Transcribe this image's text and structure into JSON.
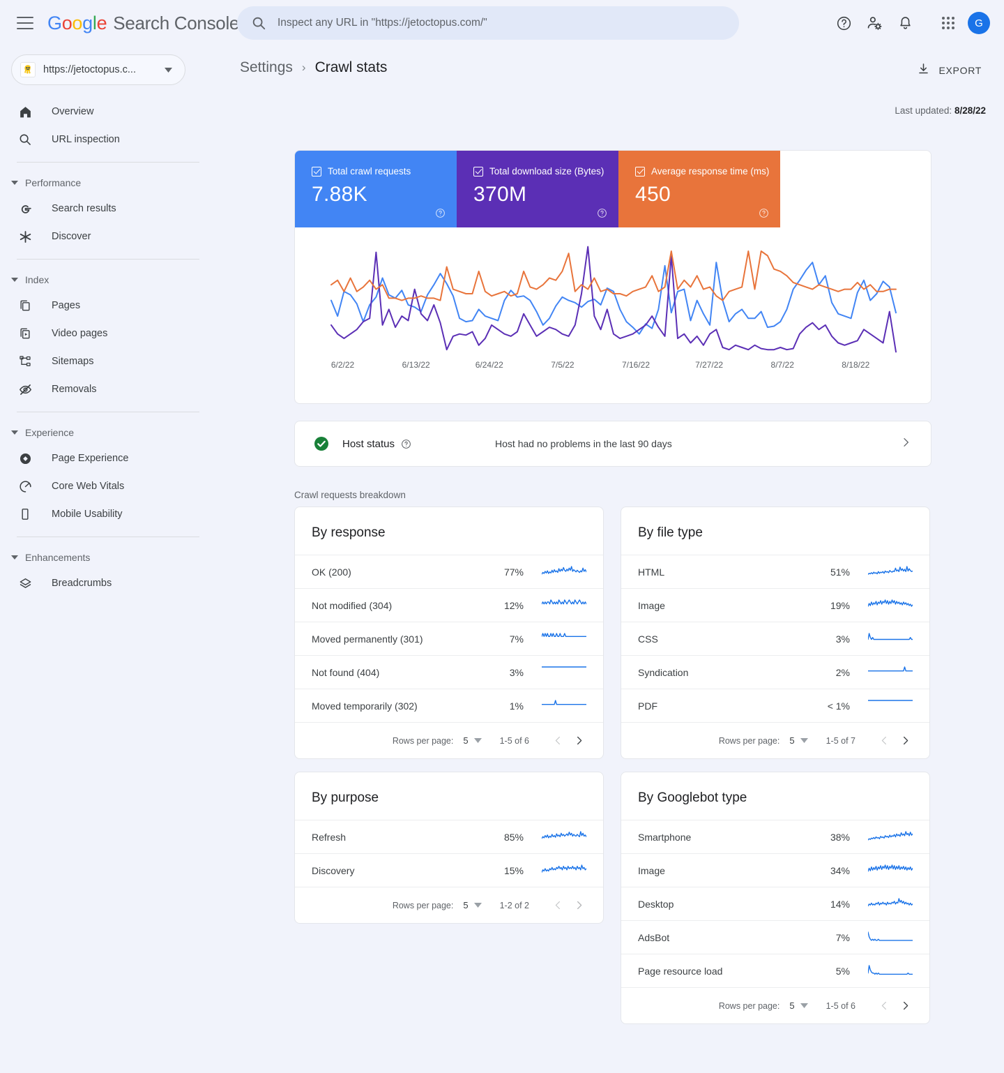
{
  "app": {
    "brand_letters": [
      "G",
      "o",
      "o",
      "g",
      "l",
      "e"
    ],
    "brand_suffix": "Search Console",
    "avatar_initial": "G"
  },
  "search": {
    "placeholder": "Inspect any URL in \"https://jetoctopus.com/\"",
    "value": ""
  },
  "topbar_icons": [
    {
      "name": "help-icon",
      "label": "Help"
    },
    {
      "name": "account-settings-icon",
      "label": "Settings"
    },
    {
      "name": "notifications-icon",
      "label": "Notifications"
    },
    {
      "name": "apps-grid-icon",
      "label": "Google apps"
    }
  ],
  "property": {
    "name": "https://jetoctopus.c...",
    "favicon": "octopus-favicon"
  },
  "sidebar": {
    "items": [
      {
        "label": "Overview",
        "icon": "home-icon"
      },
      {
        "label": "URL inspection",
        "icon": "search-icon"
      }
    ],
    "groups": [
      {
        "label": "Performance",
        "items": [
          {
            "label": "Search results",
            "icon": "google-g-icon"
          },
          {
            "label": "Discover",
            "icon": "discover-asterisk-icon"
          }
        ]
      },
      {
        "label": "Index",
        "items": [
          {
            "label": "Pages",
            "icon": "pages-copy-icon"
          },
          {
            "label": "Video pages",
            "icon": "video-pages-icon"
          },
          {
            "label": "Sitemaps",
            "icon": "sitemaps-icon"
          },
          {
            "label": "Removals",
            "icon": "removals-eye-off-icon"
          }
        ]
      },
      {
        "label": "Experience",
        "items": [
          {
            "label": "Page Experience",
            "icon": "page-experience-icon"
          },
          {
            "label": "Core Web Vitals",
            "icon": "core-web-vitals-gauge-icon"
          },
          {
            "label": "Mobile Usability",
            "icon": "mobile-device-icon"
          }
        ]
      },
      {
        "label": "Enhancements",
        "items": [
          {
            "label": "Breadcrumbs",
            "icon": "breadcrumbs-layers-icon"
          }
        ]
      }
    ]
  },
  "breadcrumb": {
    "parent": "Settings",
    "separator": "›",
    "current": "Crawl stats"
  },
  "export": {
    "label": "EXPORT",
    "icon": "download-icon"
  },
  "last_updated": {
    "prefix": "Last updated:",
    "date": "8/28/22"
  },
  "metrics": [
    {
      "label": "Total crawl requests",
      "value": "7.88K",
      "color": "#4285F4",
      "checked": true
    },
    {
      "label": "Total download size (Bytes)",
      "value": "370M",
      "color": "#5B2FB5",
      "checked": true
    },
    {
      "label": "Average response time (ms)",
      "value": "450",
      "color": "#E8743B",
      "checked": true
    }
  ],
  "host_status": {
    "label": "Host status",
    "message": "Host had no problems in the last 90 days",
    "state": "ok",
    "icon": "check-circle-icon"
  },
  "breakdown_heading": "Crawl requests breakdown",
  "pagination_labels": {
    "rows_per_page": "Rows per page:"
  },
  "cards": [
    {
      "title": "By response",
      "rows": [
        {
          "label": "OK (200)",
          "pct": "77%"
        },
        {
          "label": "Not modified (304)",
          "pct": "12%"
        },
        {
          "label": "Moved permanently (301)",
          "pct": "7%"
        },
        {
          "label": "Not found (404)",
          "pct": "3%"
        },
        {
          "label": "Moved temporarily (302)",
          "pct": "1%"
        }
      ],
      "rows_per_page": "5",
      "range": "1-5 of 6",
      "prev_enabled": false,
      "next_enabled": true
    },
    {
      "title": "By file type",
      "rows": [
        {
          "label": "HTML",
          "pct": "51%"
        },
        {
          "label": "Image",
          "pct": "19%"
        },
        {
          "label": "CSS",
          "pct": "3%"
        },
        {
          "label": "Syndication",
          "pct": "2%"
        },
        {
          "label": "PDF",
          "pct": "< 1%"
        }
      ],
      "rows_per_page": "5",
      "range": "1-5 of 7",
      "prev_enabled": false,
      "next_enabled": true
    },
    {
      "title": "By purpose",
      "rows": [
        {
          "label": "Refresh",
          "pct": "85%"
        },
        {
          "label": "Discovery",
          "pct": "15%"
        }
      ],
      "rows_per_page": "5",
      "range": "1-2 of 2",
      "prev_enabled": false,
      "next_enabled": false
    },
    {
      "title": "By Googlebot type",
      "rows": [
        {
          "label": "Smartphone",
          "pct": "38%"
        },
        {
          "label": "Image",
          "pct": "34%"
        },
        {
          "label": "Desktop",
          "pct": "14%"
        },
        {
          "label": "AdsBot",
          "pct": "7%"
        },
        {
          "label": "Page resource load",
          "pct": "5%"
        }
      ],
      "rows_per_page": "5",
      "range": "1-5 of 6",
      "prev_enabled": false,
      "next_enabled": true
    }
  ],
  "chart_data": {
    "type": "line",
    "title": "",
    "xlabel": "",
    "ylabel": "",
    "grid": false,
    "legend": "none",
    "x_tick_labels": [
      "6/2/22",
      "6/13/22",
      "6/24/22",
      "7/5/22",
      "7/16/22",
      "7/27/22",
      "8/7/22",
      "8/18/22"
    ],
    "x_tick_positions_pct": [
      7.5,
      19.0,
      30.5,
      42.0,
      53.5,
      65.0,
      76.5,
      88.0
    ],
    "series": [
      {
        "name": "Total crawl requests",
        "color": "#4285F4",
        "values": [
          52,
          38,
          60,
          57,
          49,
          33,
          48,
          55,
          72,
          57,
          54,
          61,
          48,
          46,
          42,
          57,
          66,
          76,
          67,
          56,
          36,
          33,
          34,
          44,
          38,
          36,
          34,
          52,
          61,
          55,
          56,
          52,
          42,
          30,
          36,
          47,
          55,
          52,
          50,
          46,
          51,
          53,
          48,
          63,
          60,
          44,
          33,
          28,
          22,
          31,
          27,
          44,
          83,
          41,
          60,
          62,
          34,
          52,
          40,
          30,
          86,
          52,
          33,
          40,
          44,
          36,
          36,
          42,
          28,
          29,
          33,
          44,
          62,
          70,
          79,
          86,
          66,
          74,
          50,
          40,
          38,
          36,
          59,
          70,
          52,
          58,
          69,
          64,
          41
        ]
      },
      {
        "name": "Total download size (Bytes)",
        "color": "#5B2FB5",
        "values": [
          30,
          22,
          18,
          22,
          26,
          33,
          36,
          95,
          30,
          44,
          28,
          38,
          34,
          62,
          40,
          34,
          48,
          32,
          8,
          20,
          22,
          21,
          24,
          12,
          18,
          30,
          26,
          22,
          20,
          24,
          40,
          30,
          20,
          24,
          28,
          26,
          22,
          20,
          30,
          58,
          100,
          38,
          26,
          44,
          22,
          18,
          20,
          22,
          26,
          30,
          38,
          28,
          20,
          92,
          18,
          22,
          14,
          20,
          12,
          22,
          26,
          10,
          8,
          12,
          10,
          8,
          12,
          9,
          8,
          8,
          10,
          8,
          9,
          22,
          28,
          32,
          26,
          30,
          20,
          14,
          12,
          14,
          16,
          26,
          22,
          18,
          14,
          42,
          6
        ]
      },
      {
        "name": "Average response time (ms)",
        "color": "#E8743B",
        "values": [
          66,
          70,
          60,
          72,
          60,
          64,
          70,
          62,
          66,
          54,
          54,
          52,
          54,
          54,
          56,
          54,
          54,
          52,
          82,
          62,
          60,
          58,
          58,
          78,
          60,
          56,
          58,
          60,
          56,
          58,
          78,
          64,
          62,
          66,
          72,
          70,
          78,
          94,
          60,
          66,
          62,
          72,
          60,
          62,
          58,
          58,
          56,
          60,
          62,
          64,
          74,
          60,
          64,
          96,
          62,
          70,
          64,
          74,
          62,
          64,
          56,
          52,
          60,
          62,
          64,
          96,
          62,
          96,
          92,
          80,
          78,
          74,
          68,
          66,
          64,
          62,
          66,
          64,
          62,
          60,
          62,
          62,
          68,
          62,
          66,
          60,
          60,
          62,
          62
        ]
      }
    ]
  },
  "sparklines": {
    "response": [
      [
        8,
        11,
        9,
        13,
        10,
        14,
        9,
        12,
        10,
        15,
        11,
        16,
        12,
        14,
        11,
        18,
        13,
        17,
        14,
        20,
        15,
        13,
        17,
        14,
        19,
        15,
        22,
        13,
        16,
        14,
        12,
        15,
        13,
        11,
        14,
        12,
        19,
        13,
        16,
        12
      ],
      [
        4,
        5,
        4,
        5,
        4,
        5,
        5,
        4,
        6,
        5,
        4,
        5,
        4,
        5,
        4,
        6,
        5,
        4,
        5,
        4,
        6,
        5,
        4,
        5,
        6,
        5,
        4,
        5,
        4,
        6,
        5,
        4,
        5,
        6,
        5,
        4,
        5,
        4,
        5,
        4
      ],
      [
        3,
        4,
        3,
        4,
        3,
        4,
        3,
        3,
        4,
        3,
        4,
        3,
        3,
        4,
        3,
        3,
        4,
        3,
        3,
        3,
        4,
        3,
        3,
        3,
        3,
        3,
        3,
        3,
        3,
        3,
        3,
        3,
        3,
        3,
        3,
        3,
        3,
        3,
        3,
        3
      ],
      [
        2,
        2,
        2,
        2,
        2,
        2,
        2,
        2,
        2,
        2,
        2,
        2,
        2,
        2,
        2,
        2,
        2,
        2,
        2,
        2,
        2,
        2,
        2,
        2,
        2,
        2,
        2,
        2,
        2,
        2,
        2,
        2,
        2,
        2,
        2,
        2,
        2,
        2,
        2,
        2
      ],
      [
        2,
        2,
        2,
        2,
        2,
        2,
        2,
        2,
        2,
        2,
        2,
        2,
        3,
        2,
        2,
        2,
        2,
        2,
        2,
        2,
        2,
        2,
        2,
        2,
        2,
        2,
        2,
        2,
        2,
        2,
        2,
        2,
        2,
        2,
        2,
        2,
        2,
        2,
        2,
        2
      ]
    ],
    "filetype": [
      [
        7,
        9,
        8,
        10,
        8,
        11,
        9,
        10,
        8,
        12,
        9,
        11,
        10,
        12,
        9,
        13,
        11,
        12,
        10,
        14,
        12,
        11,
        13,
        12,
        18,
        13,
        15,
        12,
        20,
        14,
        17,
        13,
        16,
        12,
        21,
        13,
        17,
        14,
        12,
        13
      ],
      [
        8,
        12,
        9,
        14,
        10,
        13,
        11,
        15,
        10,
        14,
        12,
        16,
        11,
        15,
        13,
        17,
        12,
        16,
        11,
        15,
        12,
        17,
        13,
        16,
        11,
        15,
        12,
        14,
        11,
        13,
        10,
        14,
        11,
        13,
        10,
        12,
        9,
        11,
        8,
        10
      ],
      [
        3,
        6,
        4,
        3,
        4,
        3,
        3,
        3,
        3,
        3,
        3,
        3,
        3,
        3,
        3,
        3,
        3,
        3,
        3,
        3,
        3,
        3,
        3,
        3,
        3,
        3,
        3,
        3,
        3,
        3,
        3,
        3,
        3,
        3,
        3,
        3,
        3,
        4,
        3,
        3
      ],
      [
        2,
        2,
        2,
        2,
        2,
        2,
        2,
        2,
        2,
        2,
        2,
        2,
        2,
        2,
        2,
        2,
        2,
        2,
        2,
        2,
        2,
        2,
        2,
        2,
        2,
        2,
        2,
        2,
        2,
        2,
        2,
        2,
        3,
        2,
        2,
        2,
        2,
        2,
        2,
        2
      ],
      [
        2,
        2,
        2,
        2,
        2,
        2,
        2,
        2,
        2,
        2,
        2,
        2,
        2,
        2,
        2,
        2,
        2,
        2,
        2,
        2,
        2,
        2,
        2,
        2,
        2,
        2,
        2,
        2,
        2,
        2,
        2,
        2,
        2,
        2,
        2,
        2,
        2,
        2,
        2,
        2
      ]
    ],
    "purpose": [
      [
        9,
        12,
        10,
        14,
        11,
        15,
        10,
        13,
        11,
        16,
        12,
        14,
        11,
        17,
        13,
        15,
        12,
        18,
        14,
        16,
        13,
        15,
        17,
        14,
        20,
        15,
        18,
        13,
        16,
        14,
        13,
        16,
        14,
        12,
        21,
        14,
        18,
        13,
        15,
        12
      ],
      [
        4,
        6,
        5,
        7,
        5,
        6,
        5,
        7,
        6,
        8,
        6,
        7,
        6,
        8,
        7,
        9,
        7,
        8,
        6,
        9,
        7,
        8,
        6,
        9,
        7,
        8,
        7,
        9,
        7,
        8,
        6,
        9,
        7,
        8,
        6,
        10,
        7,
        8,
        6,
        7
      ]
    ],
    "googlebot": [
      [
        6,
        8,
        7,
        9,
        8,
        10,
        8,
        11,
        9,
        10,
        8,
        12,
        10,
        11,
        9,
        13,
        11,
        12,
        10,
        14,
        11,
        13,
        12,
        15,
        11,
        16,
        13,
        15,
        12,
        18,
        14,
        16,
        13,
        20,
        15,
        17,
        13,
        19,
        14,
        16
      ],
      [
        9,
        14,
        10,
        16,
        11,
        15,
        12,
        17,
        11,
        16,
        13,
        18,
        12,
        17,
        14,
        19,
        13,
        18,
        12,
        17,
        14,
        19,
        13,
        18,
        12,
        17,
        13,
        18,
        12,
        16,
        13,
        17,
        12,
        16,
        11,
        15,
        12,
        16,
        11,
        14
      ],
      [
        5,
        7,
        6,
        8,
        6,
        7,
        6,
        8,
        7,
        9,
        6,
        8,
        7,
        9,
        7,
        8,
        6,
        9,
        7,
        8,
        7,
        9,
        8,
        10,
        7,
        9,
        8,
        13,
        9,
        11,
        8,
        10,
        7,
        9,
        7,
        8,
        6,
        8,
        6,
        7
      ],
      [
        10,
        6,
        4,
        3,
        4,
        3,
        4,
        3,
        3,
        4,
        3,
        3,
        3,
        3,
        3,
        3,
        3,
        3,
        3,
        3,
        3,
        3,
        3,
        3,
        3,
        3,
        3,
        3,
        3,
        3,
        3,
        3,
        3,
        3,
        3,
        3,
        3,
        3,
        3,
        3
      ],
      [
        4,
        11,
        7,
        5,
        4,
        4,
        3,
        4,
        3,
        4,
        3,
        3,
        3,
        3,
        3,
        3,
        3,
        3,
        3,
        3,
        3,
        3,
        3,
        3,
        3,
        3,
        3,
        3,
        3,
        3,
        3,
        3,
        3,
        3,
        3,
        4,
        3,
        3,
        3,
        3
      ]
    ]
  }
}
